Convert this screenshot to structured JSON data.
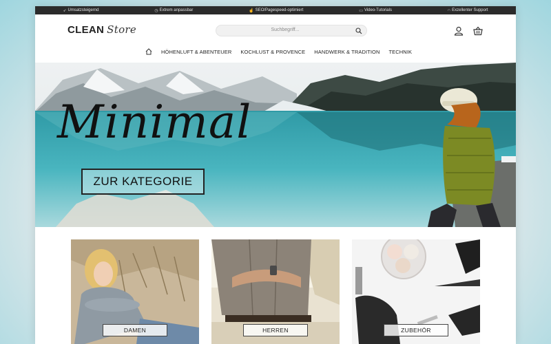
{
  "topbar": {
    "items": [
      {
        "icon": "rocket-icon",
        "label": "Umsatzsteigernd"
      },
      {
        "icon": "clock-icon",
        "label": "Extrem anpassbar"
      },
      {
        "icon": "thumbs-up-icon",
        "label": "SEO/Pagespeed-optimiert"
      },
      {
        "icon": "video-icon",
        "label": "Video-Tutorials"
      },
      {
        "icon": "headset-icon",
        "label": "Exzellenter Support"
      }
    ]
  },
  "header": {
    "logo_part1": "CLEAN",
    "logo_part2": "Store",
    "search_placeholder": "Suchbegriff...",
    "account_icon": "user-icon",
    "cart_icon": "basket-icon"
  },
  "nav": {
    "home_icon": "home-icon",
    "items": [
      "HÖHENLUFT & ABENTEUER",
      "KOCHLUST & PROVENCE",
      "HANDWERK & TRADITION",
      "TECHNIK"
    ]
  },
  "hero": {
    "title": "Minimal",
    "button_label": "ZUR KATEGORIE"
  },
  "categories": [
    {
      "label": "DAMEN"
    },
    {
      "label": "HERREN"
    },
    {
      "label": "ZUBEHÖR"
    }
  ],
  "colors": {
    "topbar_bg": "#2b2b2b",
    "lake": "#3aa7b3",
    "jacket": "#8a9a2e",
    "beanie": "#e9e6d2"
  }
}
